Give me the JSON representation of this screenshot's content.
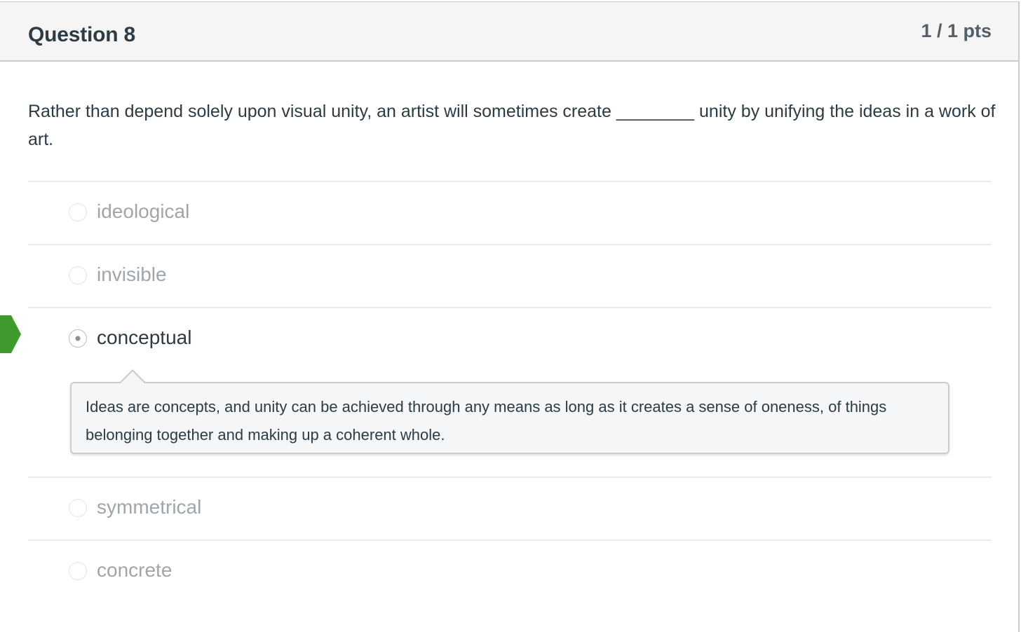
{
  "question": {
    "title": "Question 8",
    "points": "1 / 1 pts",
    "text": "Rather than depend solely upon visual unity, an artist will sometimes create ________ unity by unifying the ideas in a work of art."
  },
  "answers": [
    {
      "label": "ideological",
      "selected": false
    },
    {
      "label": "invisible",
      "selected": false
    },
    {
      "label": "conceptual",
      "selected": true
    },
    {
      "label": "symmetrical",
      "selected": false
    },
    {
      "label": "concrete",
      "selected": false
    }
  ],
  "feedback": {
    "text": "Ideas are concepts, and unity can be achieved through any means as long as it creates a sense of oneness, of things belonging together and making up a coherent whole."
  },
  "colors": {
    "correct_flag": "#3f9a2e",
    "title_text": "#2d3b45",
    "unselected_answer_text": "#9fa6ab",
    "header_background": "#f5f5f5"
  },
  "icons": {
    "correct_indicator": "correct-answer-flag-icon"
  }
}
